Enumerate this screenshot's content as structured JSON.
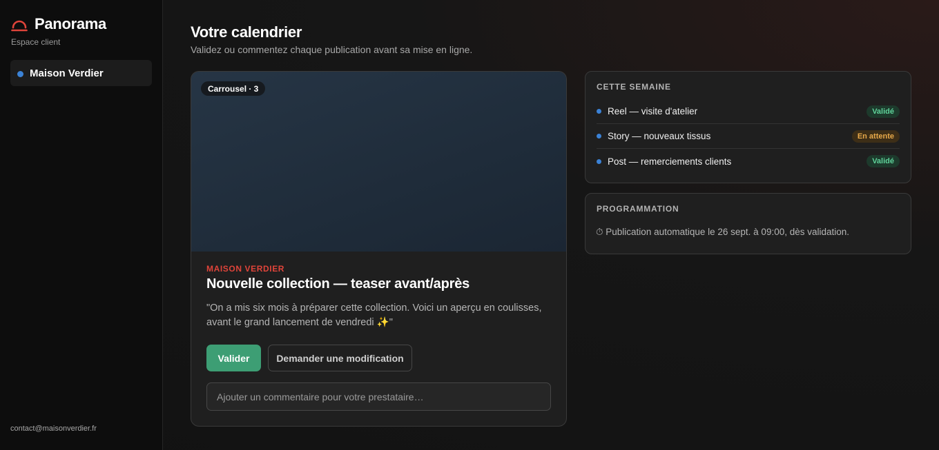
{
  "sidebar": {
    "brand": "Panorama",
    "subtitle": "Espace client",
    "client": "Maison Verdier",
    "contact": "contact@maisonverdier.fr"
  },
  "page": {
    "title": "Votre calendrier",
    "subtitle": "Validez ou commentez chaque publication avant sa mise en ligne."
  },
  "post": {
    "badge": "Carrousel · 3",
    "brand": "MAISON VERDIER",
    "title": "Nouvelle collection — teaser avant/après",
    "caption": "\"On a mis six mois à préparer cette collection. Voici un aperçu en coulisses, avant le grand lancement de vendredi ✨\"",
    "validate_label": "Valider",
    "modify_label": "Demander une modification",
    "comment_placeholder": "Ajouter un commentaire pour votre prestataire…"
  },
  "week": {
    "heading": "CETTE SEMAINE",
    "items": [
      {
        "label": "Reel — visite d'atelier",
        "status": "Validé"
      },
      {
        "label": "Story — nouveaux tissus",
        "status": "En attente"
      },
      {
        "label": "Post — remerciements clients",
        "status": "Validé"
      }
    ]
  },
  "schedule": {
    "heading": "PROGRAMMATION",
    "text": "⏱ Publication automatique le 26 sept. à 09:00, dès validation."
  },
  "colors": {
    "accent_red": "#e0443a",
    "dot_blue": "#3b82d6",
    "validate_green": "#3d9e74",
    "status_ok": "#5fd39a",
    "status_wait": "#e8a94a"
  },
  "icons": {
    "brand": "half-circle-arch-icon",
    "schedule": "stopwatch-icon"
  }
}
